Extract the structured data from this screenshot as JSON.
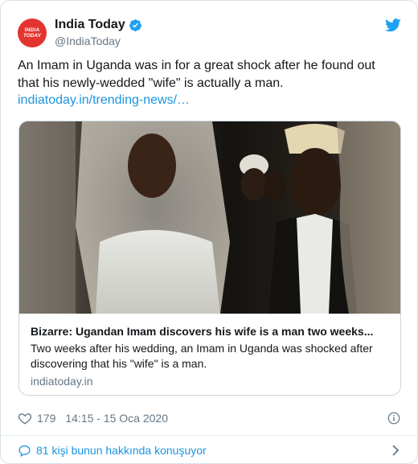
{
  "account": {
    "display_name": "India Today",
    "handle": "@IndiaToday",
    "avatar_text_line1": "INDIA",
    "avatar_text_line2": "TODAY"
  },
  "tweet": {
    "text": "An Imam in Uganda was in for a great shock after he found out that his newly-wedded \"wife\" is actually a man. ",
    "link_text": "indiatoday.in/trending-news/…"
  },
  "card": {
    "title": "Bizarre: Ugandan Imam discovers his wife is a man two weeks...",
    "description": "Two weeks after his wedding, an Imam in Uganda was shocked after discovering that his \"wife\" is a man.",
    "domain": "indiatoday.in"
  },
  "meta": {
    "likes": "179",
    "timestamp": "14:15 - 15 Oca 2020"
  },
  "footer": {
    "conversation_text": "81 kişi bunun hakkında konuşuyor"
  },
  "colors": {
    "link": "#1b95e0",
    "muted": "#657786",
    "brand_red": "#e3342f",
    "verified_blue": "#1da1f2"
  },
  "icons": [
    "verified-badge-icon",
    "twitter-bird-icon",
    "heart-icon",
    "info-icon",
    "speech-bubble-icon",
    "chevron-right-icon"
  ]
}
